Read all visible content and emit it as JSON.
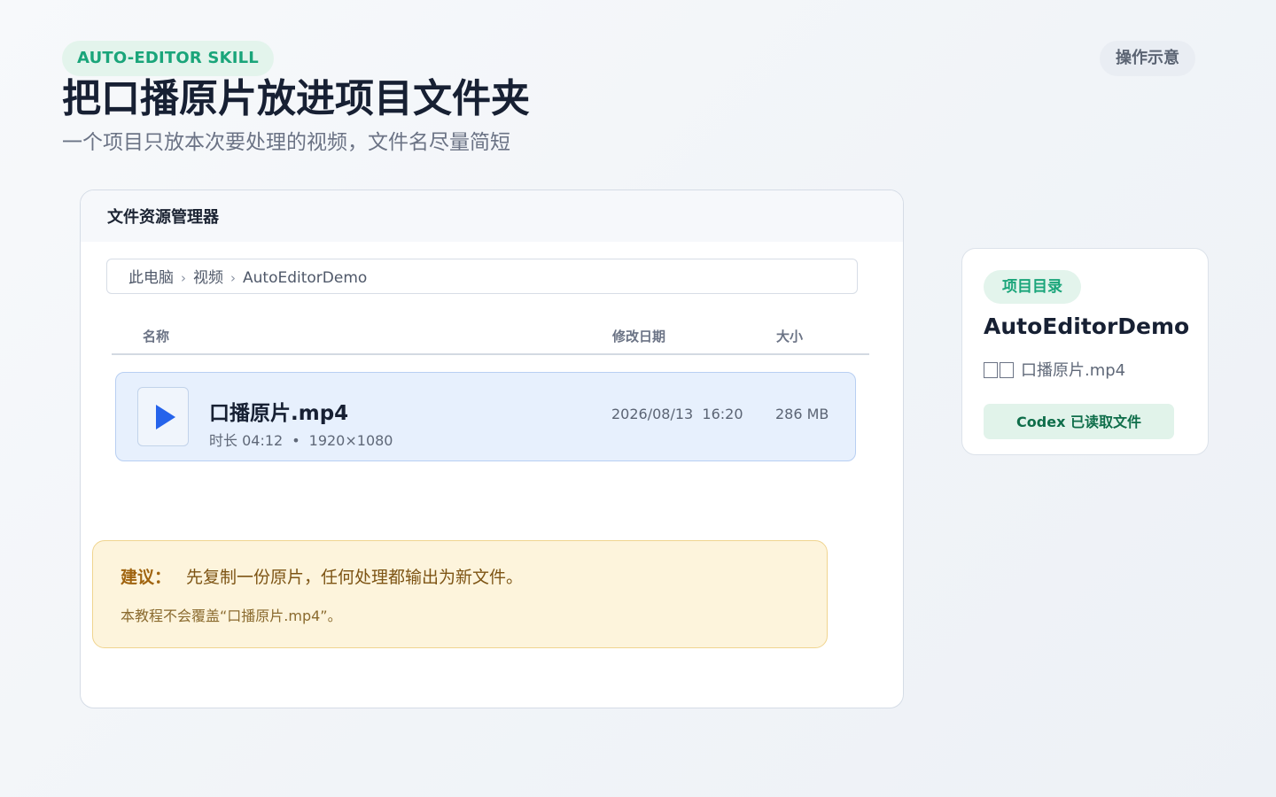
{
  "header": {
    "skill_badge": "AUTO-EDITOR SKILL",
    "demo_chip": "操作示意",
    "title": "把口播原片放进项目文件夹",
    "subtitle": "一个项目只放本次要处理的视频，文件名尽量简短"
  },
  "explorer": {
    "title": "文件资源管理器",
    "breadcrumb": [
      "此电脑",
      "视频",
      "AutoEditorDemo"
    ],
    "breadcrumb_separator": "›",
    "columns": {
      "name": "名称",
      "modified": "修改日期",
      "size": "大小"
    },
    "files": [
      {
        "name": "口播原片.mp4",
        "duration": "时长 04:12",
        "meta_separator": "•",
        "resolution": "1920×1080",
        "modified": "2026/08/13  16:20",
        "size": "286 MB",
        "icon": "play-icon"
      }
    ],
    "tip": {
      "label": "建议：",
      "text": "先复制一份原片，任何处理都输出为新文件。",
      "note": "本教程不会覆盖“口播原片.mp4”。"
    }
  },
  "project_card": {
    "badge": "项目目录",
    "name": "AutoEditorDemo",
    "file": "口播原片.mp4",
    "status": "Codex 已读取文件"
  },
  "colors": {
    "accent_green": "#1aa57a",
    "accent_blue": "#2563eb",
    "tip_background": "#fdf4dc",
    "selected_row": "#e7f0fd"
  }
}
